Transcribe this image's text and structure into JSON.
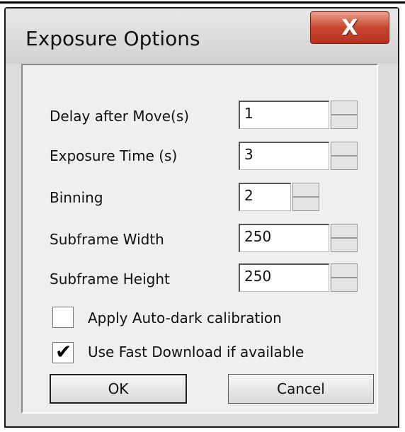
{
  "window": {
    "title": "Exposure Options",
    "close_label": "X"
  },
  "fields": [
    {
      "label": "Delay after Move(s)",
      "value": "1"
    },
    {
      "label": "Exposure Time (s)",
      "value": "3"
    },
    {
      "label": "Binning",
      "value": "2"
    },
    {
      "label": "Subframe Width",
      "value": "250"
    },
    {
      "label": "Subframe Height",
      "value": "250"
    }
  ],
  "checkboxes": [
    {
      "label": "Apply Auto-dark calibration",
      "checked": false
    },
    {
      "label": "Use Fast Download if available",
      "checked": true,
      "mark": "✔"
    }
  ],
  "buttons": {
    "ok": "OK",
    "cancel": "Cancel"
  }
}
